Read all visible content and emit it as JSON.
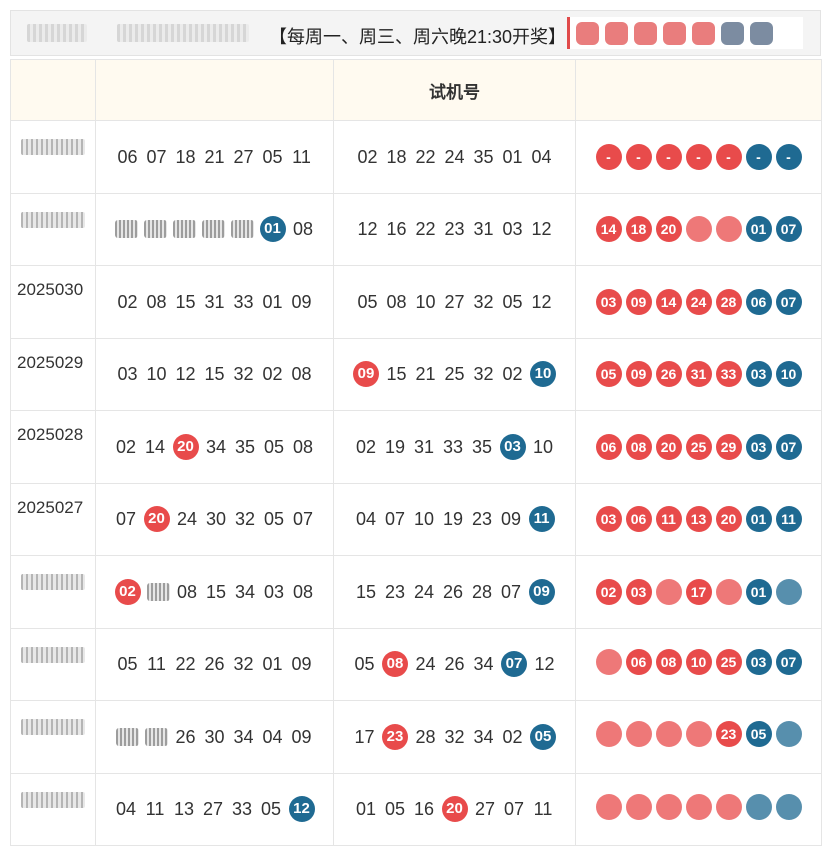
{
  "topbar": {
    "notice": "【每周一、周三、周六晚21:30开奖】"
  },
  "table": {
    "headers": [
      "",
      "",
      "试机号",
      ""
    ],
    "rows": [
      {
        "issue": "",
        "issue_blurred": true,
        "draw": [
          "06",
          "07",
          "18",
          "21",
          "27",
          "05",
          "11"
        ],
        "test": [
          "02",
          "18",
          "22",
          "24",
          "35",
          "01",
          "04"
        ],
        "balls": [
          {
            "v": "-",
            "c": "red"
          },
          {
            "v": "-",
            "c": "red"
          },
          {
            "v": "-",
            "c": "red"
          },
          {
            "v": "-",
            "c": "red"
          },
          {
            "v": "-",
            "c": "red"
          },
          {
            "v": "-",
            "c": "blue"
          },
          {
            "v": "-",
            "c": "blue"
          }
        ]
      },
      {
        "issue": "",
        "issue_blurred": true,
        "draw": [
          {
            "v": "",
            "blur": true
          },
          {
            "v": "",
            "blur": true
          },
          {
            "v": "",
            "blur": true
          },
          {
            "v": "",
            "blur": true
          },
          {
            "v": "",
            "blur": true
          },
          {
            "v": "01",
            "hl": "blue"
          },
          "08"
        ],
        "test": [
          "12",
          "16",
          "22",
          "23",
          "31",
          "03",
          "12"
        ],
        "balls": [
          {
            "v": "14",
            "c": "red"
          },
          {
            "v": "18",
            "c": "red"
          },
          {
            "v": "20",
            "c": "red"
          },
          {
            "v": "",
            "c": "red",
            "blur": true
          },
          {
            "v": "",
            "c": "red",
            "blur": true
          },
          {
            "v": "01",
            "c": "blue"
          },
          {
            "v": "07",
            "c": "blue"
          }
        ]
      },
      {
        "issue": "2025030",
        "draw": [
          "02",
          "08",
          "15",
          "31",
          "33",
          "01",
          "09"
        ],
        "test": [
          "05",
          "08",
          "10",
          "27",
          "32",
          "05",
          "12"
        ],
        "balls": [
          {
            "v": "03",
            "c": "red"
          },
          {
            "v": "09",
            "c": "red"
          },
          {
            "v": "14",
            "c": "red"
          },
          {
            "v": "24",
            "c": "red"
          },
          {
            "v": "28",
            "c": "red"
          },
          {
            "v": "06",
            "c": "blue"
          },
          {
            "v": "07",
            "c": "blue"
          }
        ]
      },
      {
        "issue": "2025029",
        "draw": [
          "03",
          "10",
          "12",
          "15",
          "32",
          "02",
          "08"
        ],
        "test": [
          {
            "v": "09",
            "hl": "red"
          },
          "15",
          "21",
          "25",
          "32",
          "02",
          {
            "v": "10",
            "hl": "blue"
          }
        ],
        "balls": [
          {
            "v": "05",
            "c": "red"
          },
          {
            "v": "09",
            "c": "red"
          },
          {
            "v": "26",
            "c": "red"
          },
          {
            "v": "31",
            "c": "red"
          },
          {
            "v": "33",
            "c": "red"
          },
          {
            "v": "03",
            "c": "blue"
          },
          {
            "v": "10",
            "c": "blue"
          }
        ]
      },
      {
        "issue": "2025028",
        "draw": [
          "02",
          "14",
          {
            "v": "20",
            "hl": "red"
          },
          "34",
          "35",
          "05",
          "08"
        ],
        "test": [
          "02",
          "19",
          "31",
          "33",
          "35",
          {
            "v": "03",
            "hl": "blue"
          },
          "10"
        ],
        "balls": [
          {
            "v": "06",
            "c": "red"
          },
          {
            "v": "08",
            "c": "red"
          },
          {
            "v": "20",
            "c": "red"
          },
          {
            "v": "25",
            "c": "red"
          },
          {
            "v": "29",
            "c": "red"
          },
          {
            "v": "03",
            "c": "blue"
          },
          {
            "v": "07",
            "c": "blue"
          }
        ]
      },
      {
        "issue": "2025027",
        "draw": [
          "07",
          {
            "v": "20",
            "hl": "red"
          },
          "24",
          "30",
          "32",
          "05",
          "07"
        ],
        "test": [
          "04",
          "07",
          "10",
          "19",
          "23",
          "09",
          {
            "v": "11",
            "hl": "blue"
          }
        ],
        "balls": [
          {
            "v": "03",
            "c": "red"
          },
          {
            "v": "06",
            "c": "red"
          },
          {
            "v": "11",
            "c": "red"
          },
          {
            "v": "13",
            "c": "red"
          },
          {
            "v": "20",
            "c": "red"
          },
          {
            "v": "01",
            "c": "blue"
          },
          {
            "v": "11",
            "c": "blue"
          }
        ]
      },
      {
        "issue": "",
        "issue_blurred": true,
        "draw": [
          {
            "v": "02",
            "hl": "red"
          },
          {
            "v": "",
            "blur": true
          },
          "08",
          "15",
          "34",
          "03",
          "08"
        ],
        "test": [
          "15",
          "23",
          "24",
          "26",
          "28",
          "07",
          {
            "v": "09",
            "hl": "blue"
          }
        ],
        "balls": [
          {
            "v": "02",
            "c": "red"
          },
          {
            "v": "03",
            "c": "red"
          },
          {
            "v": "",
            "c": "red",
            "blur": true
          },
          {
            "v": "17",
            "c": "red"
          },
          {
            "v": "",
            "c": "red",
            "blur": true
          },
          {
            "v": "01",
            "c": "blue"
          },
          {
            "v": "",
            "c": "blue",
            "blur": true
          }
        ]
      },
      {
        "issue": "",
        "issue_blurred": true,
        "draw": [
          "05",
          "11",
          "22",
          "26",
          "32",
          "01",
          "09"
        ],
        "test": [
          "05",
          {
            "v": "08",
            "hl": "red"
          },
          "24",
          "26",
          "34",
          {
            "v": "07",
            "hl": "blue"
          },
          "12"
        ],
        "balls": [
          {
            "v": "",
            "c": "red",
            "blur": true
          },
          {
            "v": "06",
            "c": "red"
          },
          {
            "v": "08",
            "c": "red"
          },
          {
            "v": "10",
            "c": "red"
          },
          {
            "v": "25",
            "c": "red"
          },
          {
            "v": "03",
            "c": "blue"
          },
          {
            "v": "07",
            "c": "blue"
          }
        ]
      },
      {
        "issue": "",
        "issue_blurred": true,
        "draw": [
          {
            "v": "",
            "blur": true
          },
          {
            "v": "",
            "blur": true
          },
          "26",
          "30",
          "34",
          "04",
          "09"
        ],
        "test": [
          "17",
          {
            "v": "23",
            "hl": "red"
          },
          "28",
          "32",
          "34",
          "02",
          {
            "v": "05",
            "hl": "blue"
          }
        ],
        "balls": [
          {
            "v": "",
            "c": "red",
            "blur": true
          },
          {
            "v": "",
            "c": "red",
            "blur": true
          },
          {
            "v": "",
            "c": "red",
            "blur": true
          },
          {
            "v": "",
            "c": "red",
            "blur": true
          },
          {
            "v": "23",
            "c": "red"
          },
          {
            "v": "05",
            "c": "blue"
          },
          {
            "v": "",
            "c": "blue",
            "blur": true
          }
        ]
      },
      {
        "issue": "",
        "issue_blurred": true,
        "draw": [
          "04",
          "11",
          "13",
          "27",
          "33",
          "05",
          {
            "v": "12",
            "hl": "blue"
          }
        ],
        "test": [
          "01",
          "05",
          "16",
          {
            "v": "20",
            "hl": "red"
          },
          "27",
          "07",
          "11"
        ],
        "balls": [
          {
            "v": "",
            "c": "red",
            "blur": true
          },
          {
            "v": "",
            "c": "red",
            "blur": true
          },
          {
            "v": "",
            "c": "red",
            "blur": true
          },
          {
            "v": "",
            "c": "red",
            "blur": true
          },
          {
            "v": "",
            "c": "red",
            "blur": true
          },
          {
            "v": "",
            "c": "blue",
            "blur": true
          },
          {
            "v": "",
            "c": "blue",
            "blur": true
          }
        ]
      }
    ]
  },
  "colors": {
    "red": "#e84b4b",
    "blue": "#1f6a92",
    "header_bg": "#fffaf0"
  }
}
